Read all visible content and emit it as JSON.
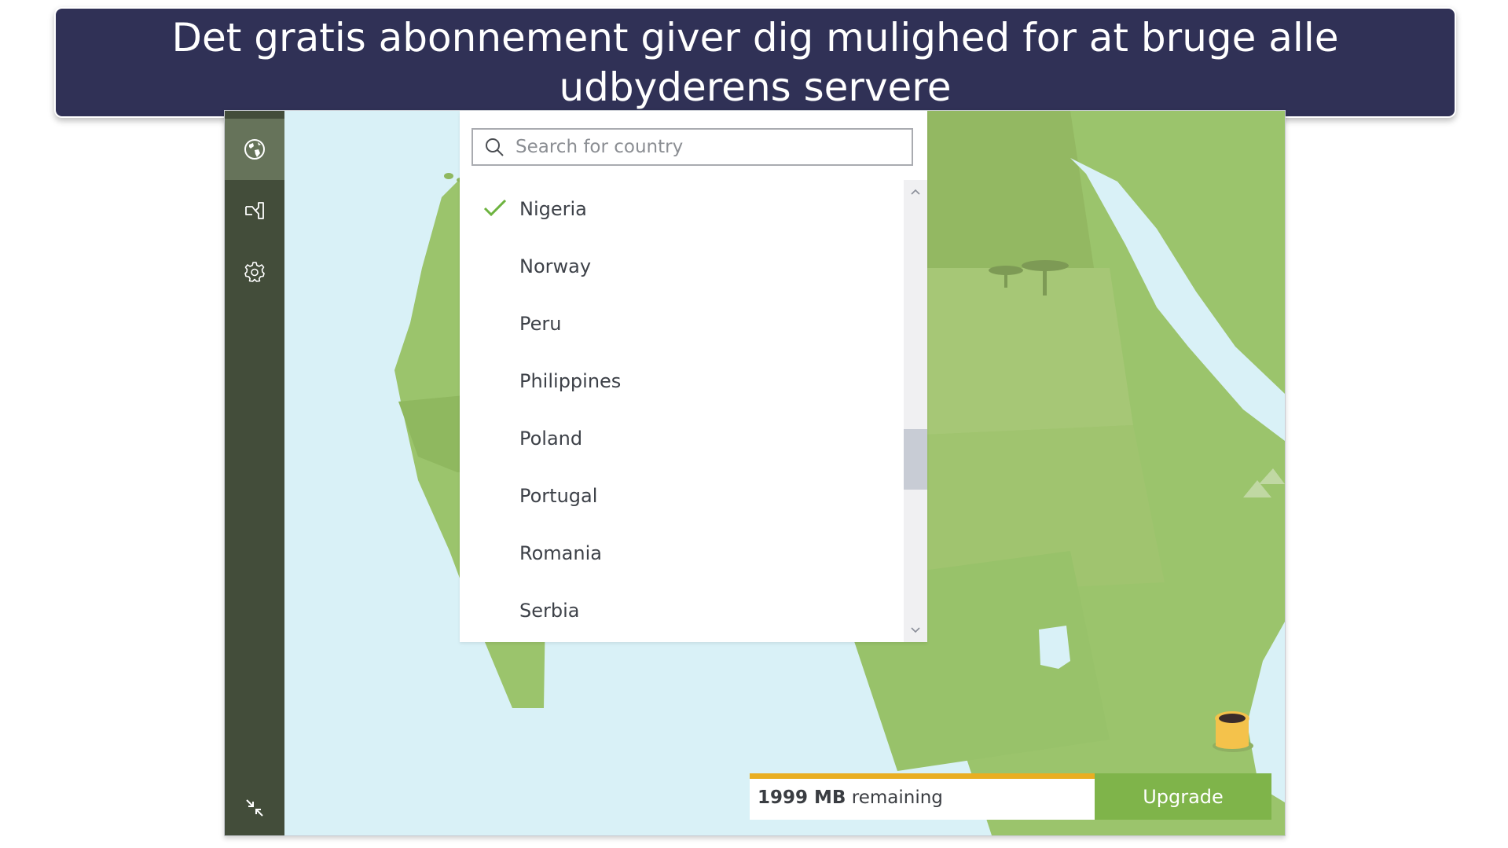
{
  "banner": {
    "title": "Det gratis abonnement giver dig mulighed for at bruge alle udbyderens servere"
  },
  "sidebar": {
    "items": [
      {
        "name": "locations",
        "icon": "globe-icon",
        "active": true
      },
      {
        "name": "network",
        "icon": "network-icon",
        "active": false
      },
      {
        "name": "settings",
        "icon": "gear-icon",
        "active": false
      }
    ],
    "collapse_icon": "collapse-icon"
  },
  "country_picker": {
    "search": {
      "placeholder": "Search for country",
      "value": ""
    },
    "countries": [
      {
        "name": "Nigeria",
        "selected": true
      },
      {
        "name": "Norway",
        "selected": false
      },
      {
        "name": "Peru",
        "selected": false
      },
      {
        "name": "Philippines",
        "selected": false
      },
      {
        "name": "Poland",
        "selected": false
      },
      {
        "name": "Portugal",
        "selected": false
      },
      {
        "name": "Romania",
        "selected": false
      },
      {
        "name": "Serbia",
        "selected": false
      }
    ]
  },
  "data_usage": {
    "amount": "1999 MB",
    "suffix": "remaining",
    "progress_fraction": 1.0
  },
  "upgrade": {
    "label": "Upgrade"
  },
  "colors": {
    "banner": "#303156",
    "sidebar": "#434d3a",
    "sidebar_active": "#66735a",
    "ocean": "#d9f1f7",
    "land": "#9bc46c",
    "accent_green": "#7fb44a",
    "progress_orange": "#e9ae22",
    "check_green": "#6db33f"
  }
}
